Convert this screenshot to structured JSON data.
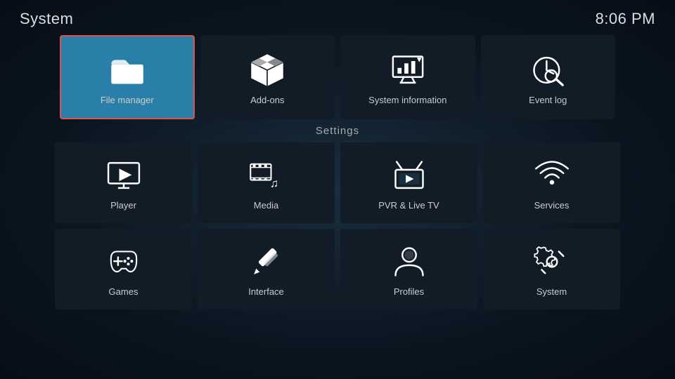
{
  "header": {
    "title": "System",
    "time": "8:06 PM"
  },
  "top_row": [
    {
      "id": "file-manager",
      "label": "File manager",
      "selected": true
    },
    {
      "id": "add-ons",
      "label": "Add-ons",
      "selected": false
    },
    {
      "id": "system-information",
      "label": "System information",
      "selected": false
    },
    {
      "id": "event-log",
      "label": "Event log",
      "selected": false
    }
  ],
  "settings_label": "Settings",
  "grid_row1": [
    {
      "id": "player",
      "label": "Player"
    },
    {
      "id": "media",
      "label": "Media"
    },
    {
      "id": "pvr-live-tv",
      "label": "PVR & Live TV"
    },
    {
      "id": "services",
      "label": "Services"
    }
  ],
  "grid_row2": [
    {
      "id": "games",
      "label": "Games"
    },
    {
      "id": "interface",
      "label": "Interface"
    },
    {
      "id": "profiles",
      "label": "Profiles"
    },
    {
      "id": "system",
      "label": "System"
    }
  ]
}
